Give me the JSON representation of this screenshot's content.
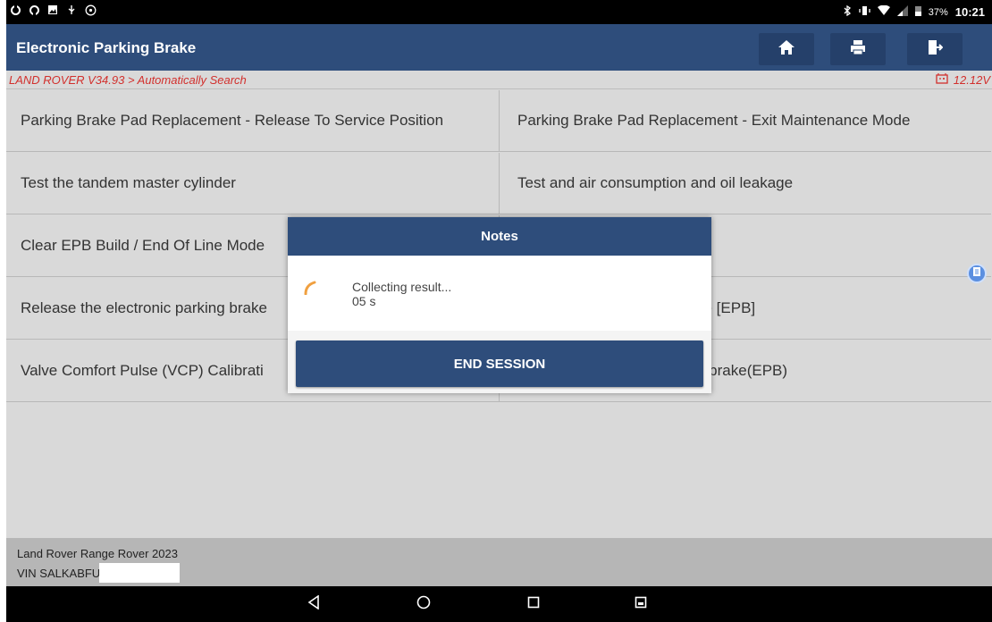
{
  "status_bar": {
    "left_icons": [
      "sync-icon",
      "sync-icon",
      "image-icon",
      "usb-icon",
      "wheel-icon"
    ],
    "right_icons": [
      "bluetooth-icon",
      "vibrate-icon",
      "wifi-icon",
      "signal-icon",
      "battery-icon"
    ],
    "battery": "37%",
    "time": "10:21"
  },
  "header": {
    "title": "Electronic Parking Brake",
    "buttons": [
      "home-icon",
      "print-icon",
      "exit-icon"
    ]
  },
  "breadcrumb": {
    "path": "LAND ROVER V34.93 > Automatically Search",
    "voltage": "12.12V"
  },
  "functions": {
    "rows": [
      [
        "Parking Brake Pad Replacement - Release To Service Position",
        "Parking Brake Pad Replacement - Exit Maintenance Mode"
      ],
      [
        "Test the tandem master cylinder",
        "Test and air consumption and oil leakage"
      ],
      [
        "Clear EPB Build / End Of Line Mode",
        ""
      ],
      [
        "Release the electronic parking brake",
        "ke [EPB]"
      ],
      [
        "Valve Comfort Pulse (VCP) Calibrati",
        "g brake(EPB)"
      ]
    ]
  },
  "vehicle": {
    "model": "Land Rover Range Rover 2023",
    "vin_label": "VIN SALKABFU"
  },
  "dialog": {
    "title": "Notes",
    "message": "Collecting result...",
    "timer": "05 s",
    "end_button": "END SESSION"
  },
  "nav": [
    "back-icon",
    "home-circle-icon",
    "recents-icon",
    "screenshot-icon"
  ],
  "colors": {
    "header_blue": "#2e4d7b",
    "crumb_red": "#d2302d",
    "spinner_orange": "#f0a040"
  }
}
